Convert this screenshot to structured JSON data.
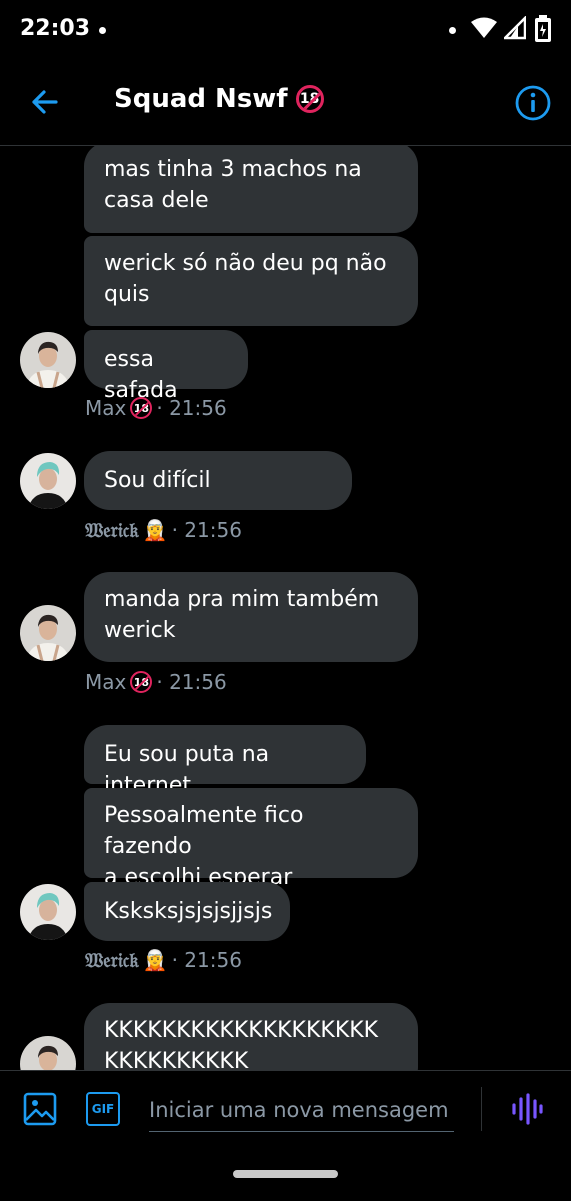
{
  "status_bar": {
    "time": "22:03"
  },
  "header": {
    "title": "Squad Nswf",
    "title_badge": "18"
  },
  "messages": [
    {
      "text": "mas tinha 3 machos na\ncasa dele"
    },
    {
      "text": "werick só não deu pq não\nquis"
    },
    {
      "text": "essa safada"
    },
    {
      "text": "Sou difícil"
    },
    {
      "text": "manda pra mim também\nwerick"
    },
    {
      "text": "Eu sou puta na internet"
    },
    {
      "text": "Pessoalmente fico fazendo\na escolhi esperar"
    },
    {
      "text": "Ksksksjsjsjsjjsjs"
    },
    {
      "text": "KKKKKKKKKKKKKKKKKKK\nKKKKKKKKKK"
    }
  ],
  "meta": [
    {
      "sender": "Max",
      "badge": "18",
      "time": "· 21:56"
    },
    {
      "sender": "𝔚𝔢𝔯𝔦𝔠𝔨",
      "emoji": "🧝",
      "time": "· 21:56"
    },
    {
      "sender": "Max",
      "badge": "18",
      "time": "· 21:56"
    },
    {
      "sender": "𝔚𝔢𝔯𝔦𝔠𝔨",
      "emoji": "🧝",
      "time": "· 21:56"
    }
  ],
  "composer": {
    "placeholder": "Iniciar uma nova mensagem",
    "gif_label": "GIF"
  },
  "colors": {
    "accent": "#1d9bf0",
    "bubble": "#2f3336",
    "badge": "#e0245e",
    "voice": "#7856ff"
  }
}
